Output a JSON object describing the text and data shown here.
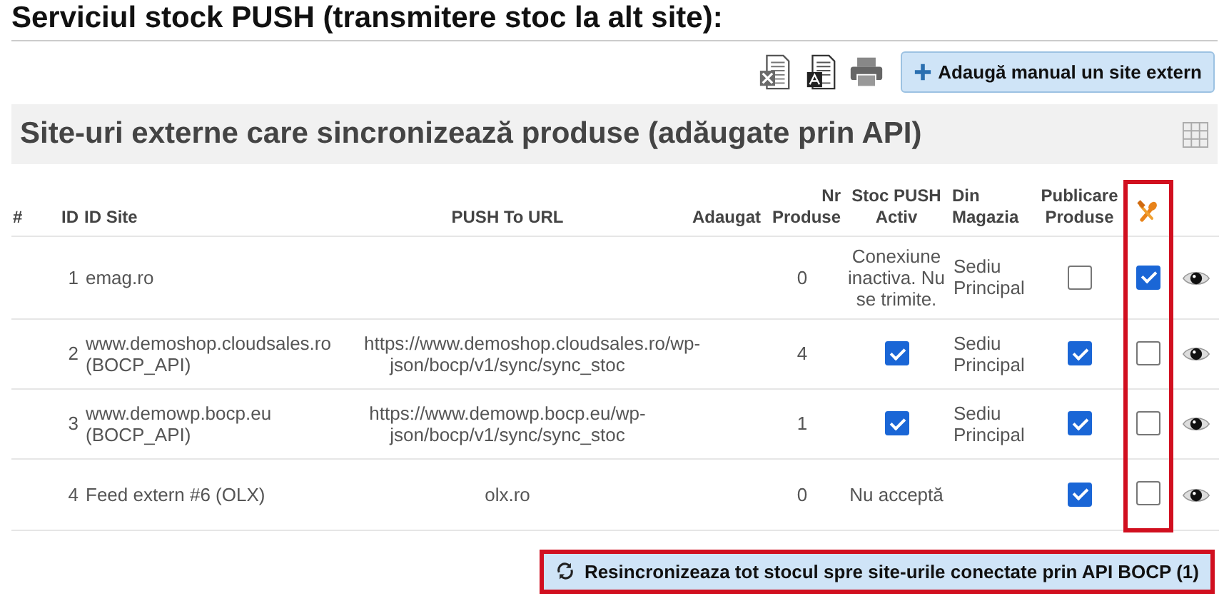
{
  "page_title": "Serviciul stock PUSH (transmitere stoc la alt site):",
  "toolbar": {
    "add_button": {
      "label": "Adaugă manual un site extern"
    }
  },
  "section": {
    "title": "Site-uri externe care sincronizează produse (adăugate prin API)"
  },
  "table": {
    "columns": [
      {
        "kind": "text",
        "label": "#",
        "highlighted": false
      },
      {
        "kind": "text",
        "label": "ID",
        "highlighted": false
      },
      {
        "kind": "text",
        "label": "ID Site",
        "highlighted": false
      },
      {
        "kind": "text",
        "label": "PUSH To URL",
        "highlighted": false
      },
      {
        "kind": "text",
        "label": "Adaugat",
        "highlighted": false
      },
      {
        "kind": "text",
        "label": "Nr Produse",
        "highlighted": false
      },
      {
        "kind": "text",
        "label": "Stoc PUSH Activ",
        "highlighted": false
      },
      {
        "kind": "text",
        "label": "Din Magazia",
        "highlighted": false
      },
      {
        "kind": "text",
        "label": "Publicare Produse",
        "highlighted": false
      },
      {
        "kind": "icon",
        "highlighted": true
      },
      {
        "kind": "blank",
        "highlighted": false
      }
    ],
    "rows": [
      {
        "id": "1",
        "site": "emag.ro",
        "url": "",
        "products": "0",
        "stock_push": {
          "kind": "text",
          "text": "Conexiune inactiva. Nu se trimite."
        },
        "warehouse": "Sediu Principal",
        "publish": false,
        "sync": true
      },
      {
        "id": "2",
        "site": "www.demoshop.cloudsales.ro (BOCP_API)",
        "url": "https://www.demoshop.cloudsales.ro/wp-json/bocp/v1/sync/sync_stoc",
        "products": "4",
        "stock_push": {
          "kind": "checkbox",
          "checked": true
        },
        "warehouse": "Sediu Principal",
        "publish": true,
        "sync": false
      },
      {
        "id": "3",
        "site": "www.demowp.bocp.eu (BOCP_API)",
        "url": "https://www.demowp.bocp.eu/wp-json/bocp/v1/sync/sync_stoc",
        "products": "1",
        "stock_push": {
          "kind": "checkbox",
          "checked": true
        },
        "warehouse": "Sediu Principal",
        "publish": true,
        "sync": false
      },
      {
        "id": "4",
        "site": "Feed extern #6 (OLX)",
        "url": "olx.ro",
        "products": "0",
        "stock_push": {
          "kind": "text",
          "text": "Nu acceptă"
        },
        "warehouse": "",
        "publish": true,
        "sync": false
      }
    ]
  },
  "resync_button": {
    "label": "Resincronizeaza tot stocul spre site-urile conectate prin API BOCP (1)",
    "highlighted": true
  }
}
